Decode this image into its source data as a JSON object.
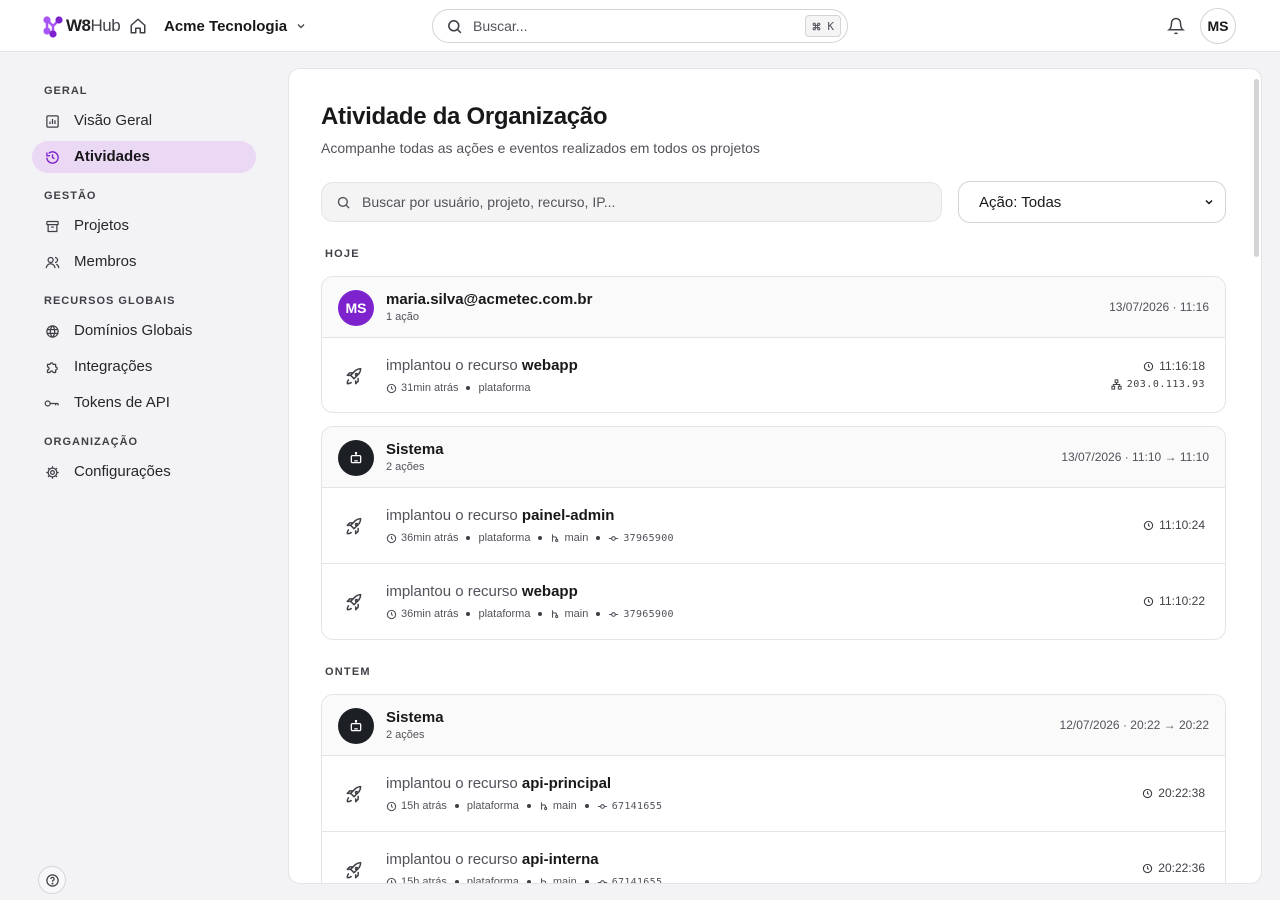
{
  "topbar": {
    "logo_main": "W8",
    "logo_sub": "Hub",
    "org_name": "Acme Tecnologia",
    "search_placeholder": "Buscar...",
    "shortcut_key": "K",
    "user_initials": "MS",
    "icons": [
      "logo-hex-icon",
      "home-icon",
      "chevron-down-icon",
      "search-icon",
      "command-icon",
      "bell-icon"
    ]
  },
  "sidebar": {
    "sections": [
      {
        "label": "GERAL",
        "items": [
          {
            "label": "Visão Geral",
            "icon": "chart-icon",
            "active": false
          },
          {
            "label": "Atividades",
            "icon": "history-icon",
            "active": true
          }
        ]
      },
      {
        "label": "GESTÃO",
        "items": [
          {
            "label": "Projetos",
            "icon": "archive-icon",
            "active": false
          },
          {
            "label": "Membros",
            "icon": "users-icon",
            "active": false
          }
        ]
      },
      {
        "label": "RECURSOS GLOBAIS",
        "items": [
          {
            "label": "Domínios Globais",
            "icon": "globe-icon",
            "active": false
          },
          {
            "label": "Integrações",
            "icon": "puzzle-icon",
            "active": false
          },
          {
            "label": "Tokens de API",
            "icon": "key-icon",
            "active": false
          }
        ]
      },
      {
        "label": "ORGANIZAÇÃO",
        "items": [
          {
            "label": "Configurações",
            "icon": "gear-icon",
            "active": false
          }
        ]
      }
    ],
    "help_icon": "help-circle-icon"
  },
  "main": {
    "title": "Atividade da Organização",
    "subtitle": "Acompanhe todas as ações e eventos realizados em todos os projetos",
    "search_placeholder": "Buscar por usuário, projeto, recurso, IP...",
    "action_filter": "Ação: Todas",
    "days": [
      {
        "label": "HOJE",
        "groups": [
          {
            "actor": "maria.silva@acmetec.com.br",
            "avatar": "MS",
            "type": "user",
            "count": "1 ação",
            "time": "13/07/2026 · 11:16",
            "rows": [
              {
                "verb": "implantou o recurso",
                "resource": "webapp",
                "ago": "31min atrás",
                "project": "plataforma",
                "branch": "",
                "commit": "",
                "time": "11:16:18",
                "ip": "203.0.113.93"
              }
            ]
          },
          {
            "actor": "Sistema",
            "avatar": "",
            "type": "system",
            "count": "2 ações",
            "time": "13/07/2026 · 11:10 → 11:10",
            "rows": [
              {
                "verb": "implantou o recurso",
                "resource": "painel-admin",
                "ago": "36min atrás",
                "project": "plataforma",
                "branch": "main",
                "commit": "37965900",
                "time": "11:10:24",
                "ip": ""
              },
              {
                "verb": "implantou o recurso",
                "resource": "webapp",
                "ago": "36min atrás",
                "project": "plataforma",
                "branch": "main",
                "commit": "37965900",
                "time": "11:10:22",
                "ip": ""
              }
            ]
          }
        ]
      },
      {
        "label": "ONTEM",
        "groups": [
          {
            "actor": "Sistema",
            "avatar": "",
            "type": "system",
            "count": "2 ações",
            "time": "12/07/2026 · 20:22 → 20:22",
            "rows": [
              {
                "verb": "implantou o recurso",
                "resource": "api-principal",
                "ago": "15h atrás",
                "project": "plataforma",
                "branch": "main",
                "commit": "67141655",
                "time": "20:22:38",
                "ip": ""
              },
              {
                "verb": "implantou o recurso",
                "resource": "api-interna",
                "ago": "15h atrás",
                "project": "plataforma",
                "branch": "main",
                "commit": "67141655",
                "time": "20:22:36",
                "ip": ""
              }
            ]
          }
        ]
      }
    ]
  },
  "colors": {
    "accent": "#7e22ce",
    "active_bg": "#ead8f4",
    "system_avatar": "#1c1f24"
  }
}
